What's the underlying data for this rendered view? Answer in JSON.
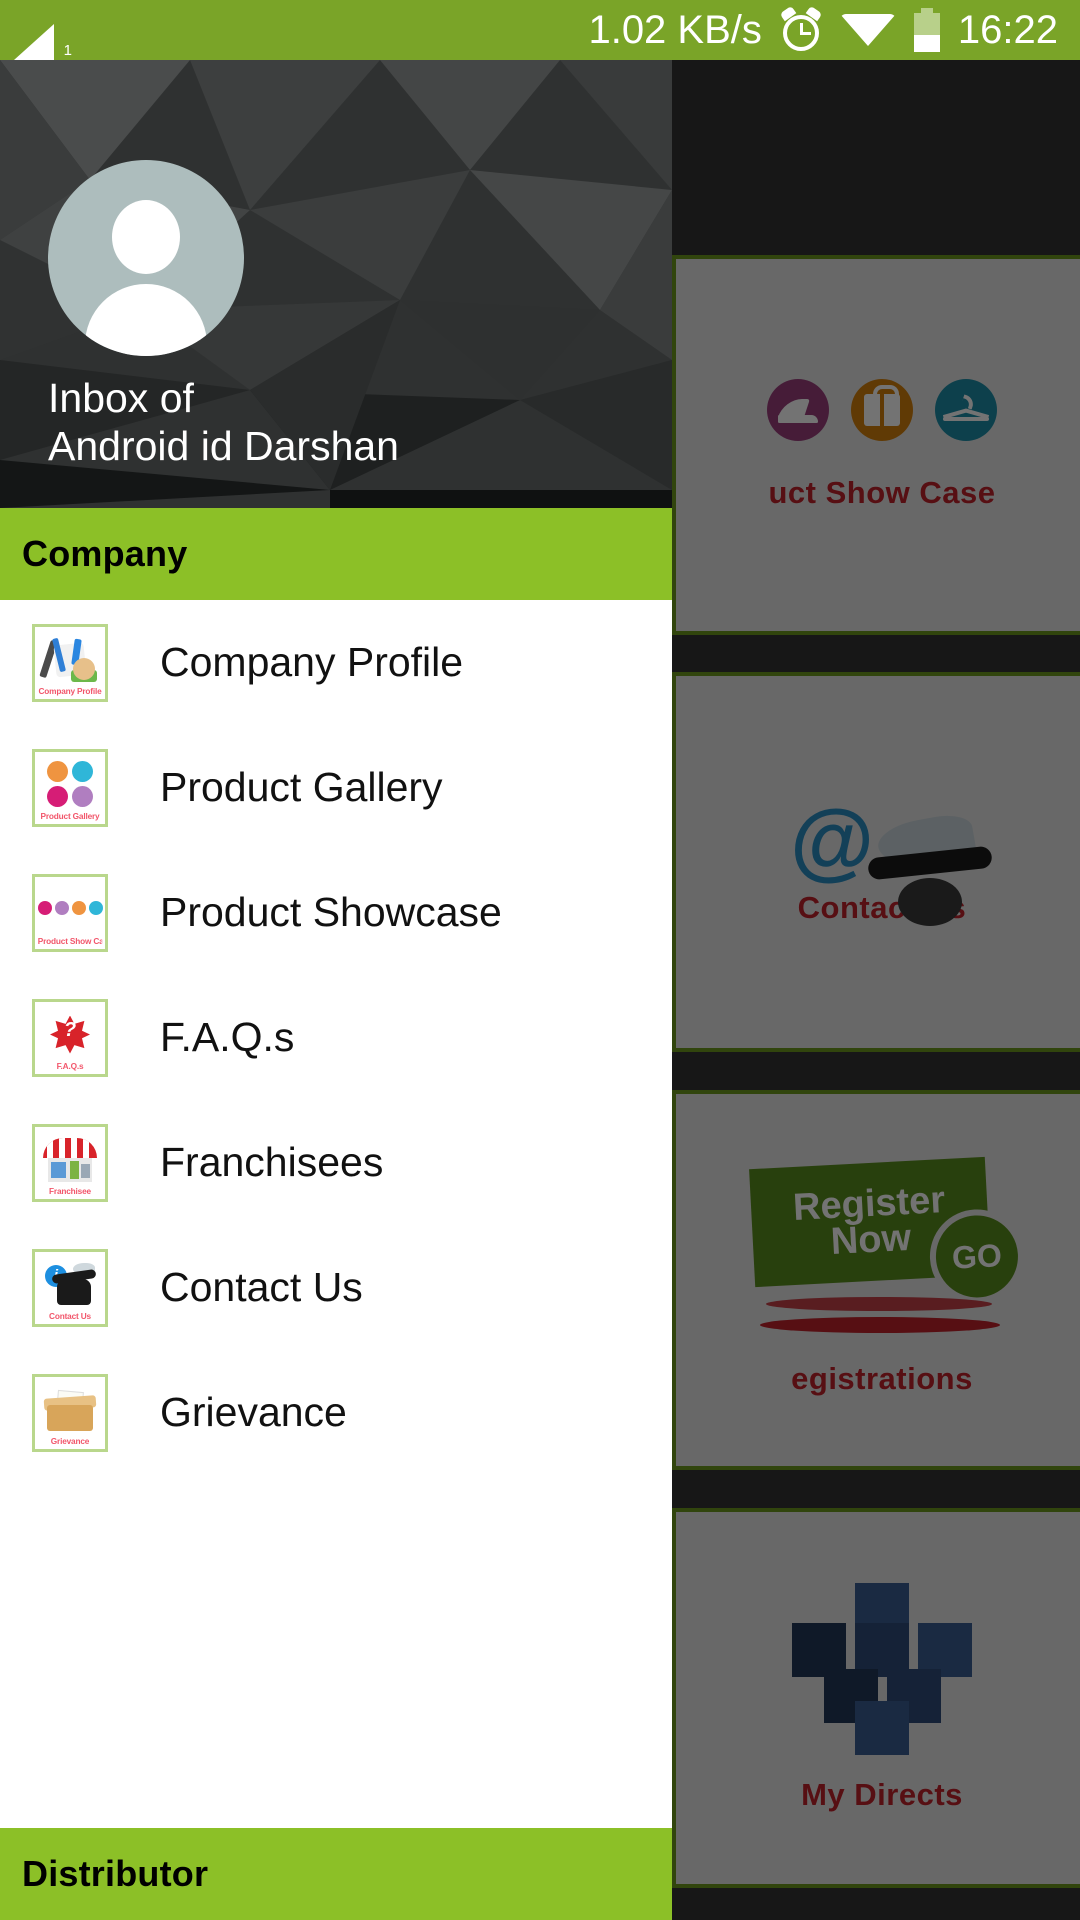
{
  "status_bar": {
    "signal_icon": "signal-bars-icon",
    "signal_sub": "1",
    "network_speed": "1.02 KB/s",
    "alarm_icon": "alarm-clock-icon",
    "wifi_icon": "wifi-icon",
    "battery_icon": "battery-icon",
    "time": "16:22",
    "background_color": "#7aa428",
    "text_color": "#ffffff"
  },
  "drawer": {
    "header": {
      "avatar_icon": "person-avatar-placeholder",
      "line1": "Inbox of",
      "line2": "Android id Darshan",
      "background_color": "#2f3131"
    },
    "sections": [
      {
        "title": "Company",
        "accent_color": "#8cc027",
        "items": [
          {
            "label": "Company Profile",
            "icon": "company-profile-icon",
            "icon_caption": "Company Profile"
          },
          {
            "label": "Product Gallery",
            "icon": "product-gallery-icon",
            "icon_caption": "Product Gallery"
          },
          {
            "label": "Product Showcase",
            "icon": "product-showcase-icon",
            "icon_caption": "Product Show Case"
          },
          {
            "label": "F.A.Q.s",
            "icon": "faq-icon",
            "icon_caption": "F.A.Q.s"
          },
          {
            "label": "Franchisees",
            "icon": "franchisees-icon",
            "icon_caption": "Franchisee"
          },
          {
            "label": "Contact Us",
            "icon": "contact-us-icon",
            "icon_caption": "Contact Us"
          },
          {
            "label": "Grievance",
            "icon": "grievance-icon",
            "icon_caption": "Grievance"
          }
        ]
      },
      {
        "title": "Distributor",
        "accent_color": "#8cc027",
        "items": []
      }
    ]
  },
  "background_grid": {
    "tiles": [
      {
        "caption": "Product Show Case",
        "visible_caption": "uct Show Case",
        "icon": "showcase-circles-icon"
      },
      {
        "caption": "Contact Us",
        "visible_caption": "Contact Us",
        "icon": "at-phone-wings-icon"
      },
      {
        "caption": "Registrations",
        "visible_caption": "egistrations",
        "icon": "register-now-go-icon",
        "badge_text": "GO",
        "tag_line1": "Register",
        "tag_line2": "Now"
      },
      {
        "caption": "My Directs",
        "visible_caption": "My Directs",
        "icon": "network-cubes-icon"
      }
    ],
    "tile_border_color": "#6e9a1e",
    "tile_background": "#e6e6e6",
    "caption_color": "#c0222b"
  }
}
